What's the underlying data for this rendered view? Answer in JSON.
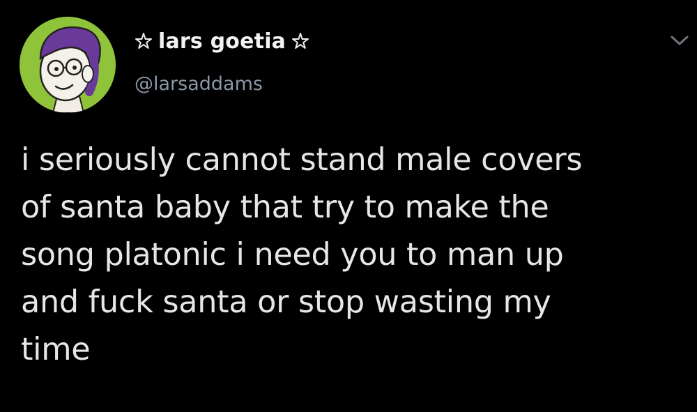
{
  "tweet": {
    "display_name": "lars goetia",
    "handle": "@larsaddams",
    "text": "i seriously cannot stand male covers\nof santa baby that try to make the\nsong platonic i need you to man up\nand fuck santa or stop wasting my\ntime"
  },
  "icons": {
    "name_decoration": "pentagram-icon",
    "menu": "chevron-down-icon"
  },
  "colors": {
    "background": "#000000",
    "text": "#e6e6e6",
    "handle": "#8b98a5",
    "avatar_bg": "#8fc43a",
    "avatar_hair": "#6a3a9a"
  }
}
